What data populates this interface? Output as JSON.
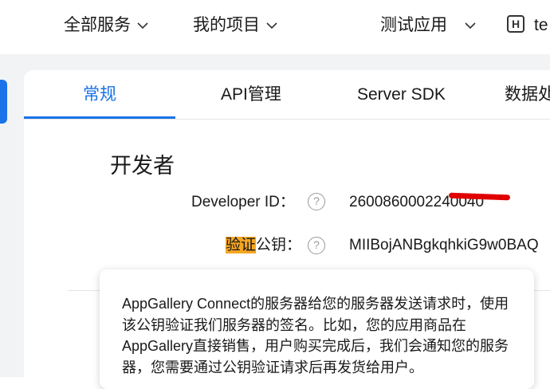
{
  "topnav": {
    "all_services": "全部服务",
    "my_projects": "我的项目",
    "current_app": "测试应用",
    "app_badge": "H",
    "user_partial": "te"
  },
  "tabs": [
    {
      "label": "常规",
      "active": true
    },
    {
      "label": "API管理",
      "active": false
    },
    {
      "label": "Server SDK",
      "active": false
    },
    {
      "label": "数据处",
      "active": false
    }
  ],
  "section": {
    "title": "开发者"
  },
  "fields": {
    "developer_id_label": "Developer ID：",
    "developer_id_value": "2600860002240040",
    "public_key_label_highlight": "验证",
    "public_key_label_rest": "公钥：",
    "public_key_value": "MIIBojANBgkqhkiG9w0BAQ"
  },
  "help_icon_glyph": "?",
  "tooltip": {
    "text": "AppGallery Connect的服务器给您的服务器发送请求时，使用该公钥验证我们服务器的签名。比如，您的应用商品在AppGallery直接销售，用户购买完成后，我们会通知您的服务器，您需要通过公钥验证请求后再发货给用户。"
  },
  "colors": {
    "accent": "#1a73e8",
    "highlight": "#f5a623",
    "redaction": "#e00000"
  }
}
